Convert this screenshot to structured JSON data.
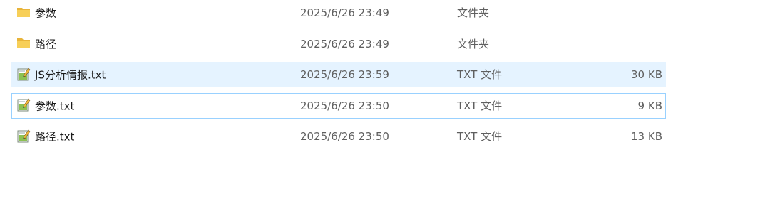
{
  "files": [
    {
      "name": "参数",
      "date": "2025/6/26 23:49",
      "type": "文件夹",
      "size": "",
      "icon": "folder-icon",
      "state": "normal"
    },
    {
      "name": "路径",
      "date": "2025/6/26 23:49",
      "type": "文件夹",
      "size": "",
      "icon": "folder-icon",
      "state": "normal"
    },
    {
      "name": "JS分析情报.txt",
      "date": "2025/6/26 23:59",
      "type": "TXT 文件",
      "size": "30 KB",
      "icon": "text-file-icon",
      "state": "hover"
    },
    {
      "name": "参数.txt",
      "date": "2025/6/26 23:50",
      "type": "TXT 文件",
      "size": "9 KB",
      "icon": "text-file-icon",
      "state": "focused"
    },
    {
      "name": "路径.txt",
      "date": "2025/6/26 23:50",
      "type": "TXT 文件",
      "size": "13 KB",
      "icon": "text-file-icon",
      "state": "normal"
    }
  ],
  "colors": {
    "hover_bg": "#e5f3ff",
    "focus_border": "#99d1ff",
    "folder_yellow": "#f4c542",
    "text_secondary": "#5f5f5f"
  }
}
